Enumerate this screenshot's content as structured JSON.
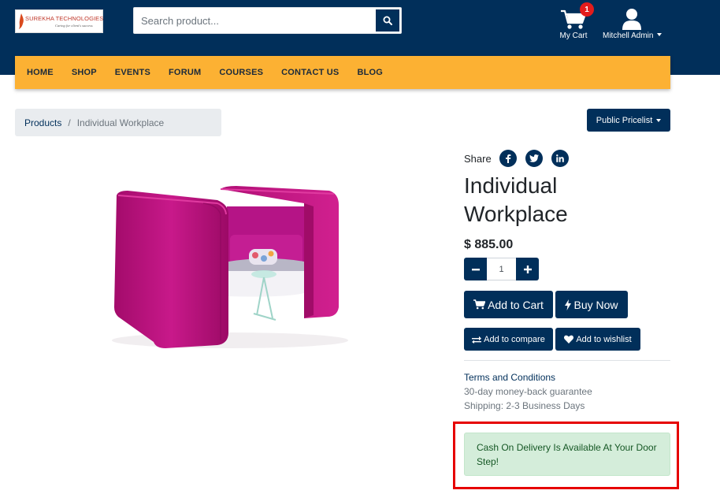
{
  "header": {
    "logo": {
      "name": "SUREKHA TECHNOLOGIES",
      "tagline": "Caring for client's success"
    },
    "search": {
      "placeholder": "Search product...",
      "value": ""
    },
    "cart": {
      "label": "My Cart",
      "count": "1"
    },
    "user": {
      "label": "Mitchell Admin"
    }
  },
  "nav": {
    "items": [
      "HOME",
      "SHOP",
      "EVENTS",
      "FORUM",
      "COURSES",
      "CONTACT US",
      "BLOG"
    ]
  },
  "breadcrumb": {
    "parent": "Products",
    "separator": "/",
    "current": "Individual Workplace"
  },
  "pricelist": {
    "label": "Public Pricelist"
  },
  "product": {
    "share_label": "Share",
    "social_icons": [
      "facebook-icon",
      "twitter-icon",
      "linkedin-icon"
    ],
    "name": "Individual Workplace",
    "price": "$ 885.00",
    "quantity": "1",
    "add_to_cart": "Add to Cart",
    "buy_now": "Buy Now",
    "add_to_compare": "Add to compare",
    "add_to_wishlist": "Add to wishlist",
    "terms": "Terms and Conditions",
    "guarantee": "30-day money-back guarantee",
    "shipping": "Shipping: 2-3 Business Days",
    "cod_message": "Cash On Delivery Is Available At Your Door Step!"
  },
  "colors": {
    "brand_navy": "#012f5a",
    "nav_orange": "#fcb133",
    "alert_green_bg": "#d4edda",
    "alert_green_text": "#155724",
    "highlight_red": "#e60000",
    "badge_red": "#e31c1c",
    "product_magenta": "#c2127f"
  }
}
